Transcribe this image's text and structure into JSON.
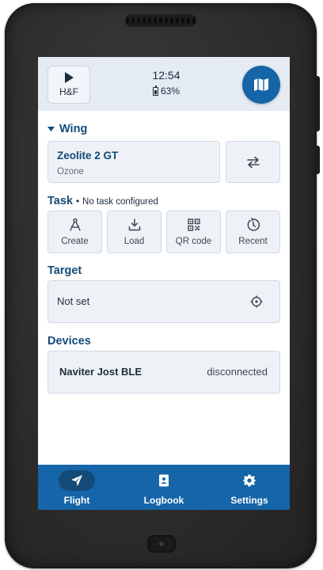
{
  "topbar": {
    "hf_label": "H&F",
    "time": "12:54",
    "battery": "63%"
  },
  "wing": {
    "title": "Wing",
    "name": "Zeolite 2 GT",
    "maker": "Ozone"
  },
  "task": {
    "title": "Task",
    "separator": "•",
    "status": "No task configured",
    "buttons": [
      {
        "label": "Create",
        "icon": "compass-draw-icon"
      },
      {
        "label": "Load",
        "icon": "download-tray-icon"
      },
      {
        "label": "QR code",
        "icon": "qr-code-icon"
      },
      {
        "label": "Recent",
        "icon": "history-icon"
      }
    ]
  },
  "target": {
    "title": "Target",
    "value": "Not set"
  },
  "devices": {
    "title": "Devices",
    "items": [
      {
        "name": "Naviter Jost BLE",
        "status": "disconnected"
      }
    ]
  },
  "nav": {
    "items": [
      {
        "label": "Flight",
        "icon": "send-icon",
        "active": true
      },
      {
        "label": "Logbook",
        "icon": "contacts-book-icon",
        "active": false
      },
      {
        "label": "Settings",
        "icon": "gear-icon",
        "active": false
      }
    ]
  },
  "colors": {
    "primary": "#1565a8",
    "title_text": "#134a78",
    "topbar_bg": "#e4ebf3",
    "card_bg": "#eef2f7"
  }
}
